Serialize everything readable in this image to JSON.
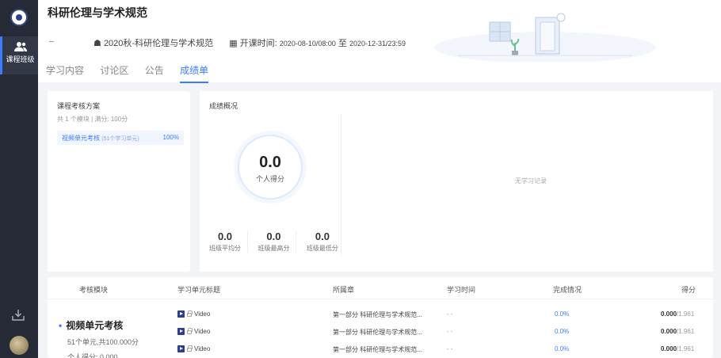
{
  "sidebar": {
    "active_label": "课程班级"
  },
  "header": {
    "title": "科研伦理与学术规范",
    "class_name": "2020秋-科研伦理与学术规范",
    "time_label": "开课时间:",
    "start": "2020-08-10/08:00",
    "to": "至",
    "end": "2020-12-31/23:59"
  },
  "tabs": [
    {
      "label": "学习内容"
    },
    {
      "label": "讨论区"
    },
    {
      "label": "公告"
    },
    {
      "label": "成绩单"
    }
  ],
  "plan": {
    "title": "课程考核方案",
    "subtitle": "共 1 个模块 | 满分: 100分",
    "item_label": "视频单元考核",
    "item_sub": "(51个学习单元)",
    "item_pct": "100%"
  },
  "overview": {
    "title": "成绩概况",
    "personal_score": "0.0",
    "personal_label": "个人得分",
    "stats": [
      {
        "value": "0.0",
        "label": "班级平均分"
      },
      {
        "value": "0.0",
        "label": "班级最高分"
      },
      {
        "value": "0.0",
        "label": "班级最低分"
      }
    ],
    "empty_text": "无学习记录"
  },
  "table": {
    "headers": [
      "考核模块",
      "学习单元标题",
      "所属章",
      "学习时间",
      "完成情况",
      "得分"
    ],
    "module": {
      "name": "视频单元考核",
      "units": "51个单元,共100.000分",
      "score": "个人得分: 0.000"
    },
    "rows": [
      {
        "title": "Video",
        "chapter": "第一部分 科研伦理与学术规范...",
        "time": "- -",
        "completion": "0.0%",
        "score": "0.000",
        "total": "/1.961"
      },
      {
        "title": "Video",
        "chapter": "第一部分 科研伦理与学术规范...",
        "time": "- -",
        "completion": "0.0%",
        "score": "0.000",
        "total": "/1.961"
      },
      {
        "title": "Video",
        "chapter": "第一部分 科研伦理与学术规范...",
        "time": "- -",
        "completion": "0.0%",
        "score": "0.000",
        "total": "/1.961"
      }
    ]
  },
  "colors": {
    "accent": "#3b7cff",
    "sidebar": "#262a36"
  }
}
